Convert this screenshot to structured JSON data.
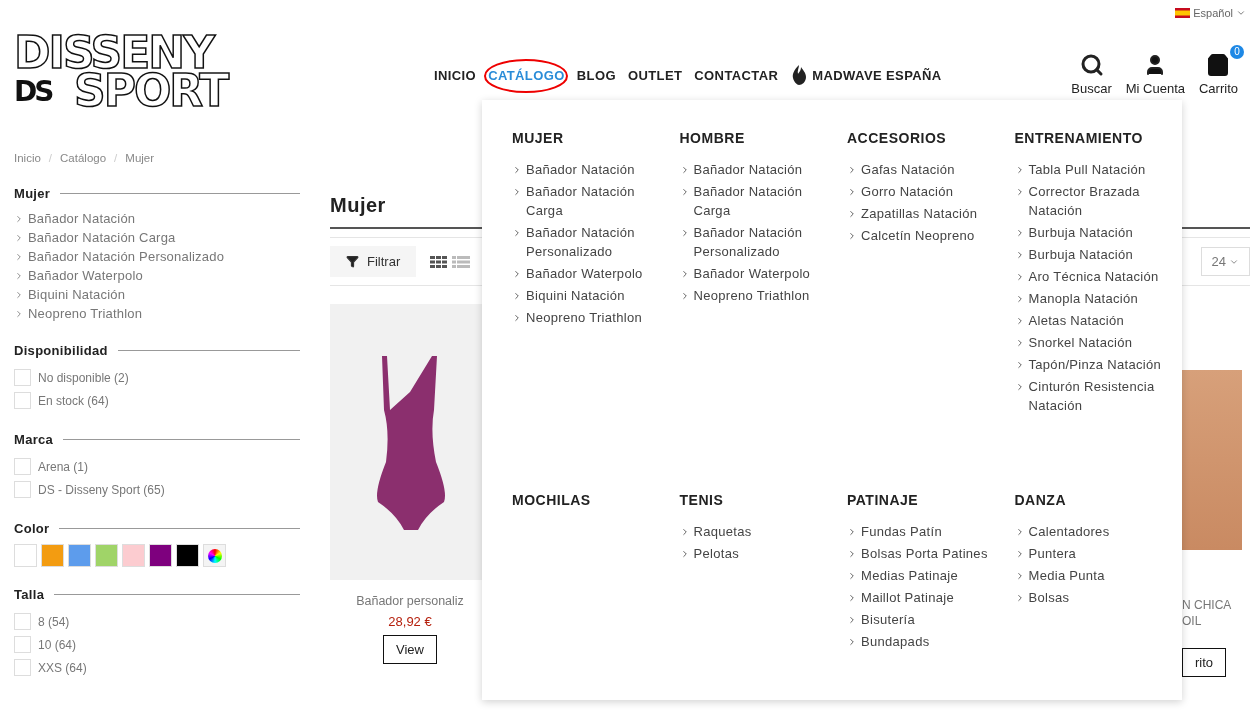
{
  "language": {
    "label": "Español"
  },
  "logo": {
    "line1": "DISSENY",
    "badge": "DS",
    "line2": "SPORT"
  },
  "nav": [
    {
      "label": "INICIO",
      "selected": false
    },
    {
      "label": "CATÁLOGO",
      "selected": true
    },
    {
      "label": "BLOG",
      "selected": false
    },
    {
      "label": "OUTLET",
      "selected": false
    },
    {
      "label": "CONTACTAR",
      "selected": false
    },
    {
      "label": "MADWAVE ESPAÑA",
      "selected": false,
      "kind": "brand"
    }
  ],
  "actions": [
    {
      "kind": "search",
      "label": "Buscar"
    },
    {
      "kind": "account",
      "label": "Mi Cuenta"
    },
    {
      "kind": "cart",
      "label": "Carrito",
      "badge": "0"
    }
  ],
  "breadcrumb": {
    "separator": "/",
    "items": [
      "Inicio",
      "Catálogo",
      "Mujer"
    ]
  },
  "filters": [
    {
      "title": "Mujer",
      "kind": "links",
      "items": [
        {
          "label": "Bañador Natación"
        },
        {
          "label": "Bañador Natación Carga"
        },
        {
          "label": "Bañador Natación Personalizado"
        },
        {
          "label": "Bañador Waterpolo"
        },
        {
          "label": "Biquini Natación"
        },
        {
          "label": "Neopreno Triathlon"
        }
      ]
    },
    {
      "title": "Disponibilidad",
      "kind": "checkboxes",
      "items": [
        {
          "label": "No disponible (2)",
          "checked": false
        },
        {
          "label": "En stock (64)",
          "checked": false
        }
      ]
    },
    {
      "title": "Marca",
      "kind": "checkboxes",
      "items": [
        {
          "label": "Arena (1)",
          "checked": false
        },
        {
          "label": "DS - Disseny Sport (65)",
          "checked": false
        }
      ]
    },
    {
      "title": "Color",
      "kind": "swatches",
      "items": [
        {
          "kind": "solid",
          "color": "#ffffff"
        },
        {
          "kind": "solid",
          "color": "#f39c11"
        },
        {
          "kind": "solid",
          "color": "#5d9cec"
        },
        {
          "kind": "solid",
          "color": "#a0d468"
        },
        {
          "kind": "solid",
          "color": "#fcccd0"
        },
        {
          "kind": "solid",
          "color": "#7e007e"
        },
        {
          "kind": "solid",
          "color": "#000000"
        },
        {
          "kind": "multicolor"
        }
      ]
    },
    {
      "title": "Talla",
      "kind": "checkboxes",
      "items": [
        {
          "label": "8 (54)",
          "checked": false
        },
        {
          "label": "10 (64)",
          "checked": false
        },
        {
          "label": "XXS (64)",
          "checked": false
        }
      ]
    }
  ],
  "content": {
    "title": "Mujer",
    "filter_button": "Filtrar",
    "per_page": "24",
    "products": [
      {
        "kind": "full",
        "title": "Bañador personaliz",
        "price": "28,92 €",
        "button": "View"
      },
      {
        "kind": "partial",
        "title_lines": [
          "N CHICA",
          "OIL"
        ],
        "button": "rito"
      }
    ]
  },
  "mega_menu": [
    {
      "title": "MUJER",
      "items": [
        "Bañador Natación",
        "Bañador Natación Carga",
        "Bañador Natación Personalizado",
        "Bañador Waterpolo",
        "Biquini Natación",
        "Neopreno Triathlon"
      ]
    },
    {
      "title": "HOMBRE",
      "items": [
        "Bañador Natación",
        "Bañador Natación Carga",
        "Bañador Natación Personalizado",
        "Bañador Waterpolo",
        "Neopreno Triathlon"
      ]
    },
    {
      "title": "ACCESORIOS",
      "items": [
        "Gafas Natación",
        "Gorro Natación",
        "Zapatillas Natación",
        "Calcetín Neopreno"
      ]
    },
    {
      "title": "ENTRENAMIENTO",
      "items": [
        "Tabla Pull Natación",
        "Corrector Brazada Natación",
        "Burbuja Natación",
        "Burbuja Natación",
        "Aro Técnica Natación",
        "Manopla Natación",
        "Aletas Natación",
        "Snorkel Natación",
        "Tapón/Pinza Natación",
        "Cinturón Resistencia Natación"
      ]
    },
    {
      "title": "MOCHILAS"
    },
    {
      "title": "TENIS",
      "items": [
        "Raquetas",
        "Pelotas"
      ]
    },
    {
      "title": "PATINAJE",
      "items": [
        "Fundas Patín",
        "Bolsas Porta Patines",
        "Medias Patinaje",
        "Maillot Patinaje",
        "Bisutería",
        "Bundapads"
      ]
    },
    {
      "title": "DANZA",
      "items": [
        "Calentadores",
        "Puntera",
        "Media Punta",
        "Bolsas"
      ]
    }
  ]
}
